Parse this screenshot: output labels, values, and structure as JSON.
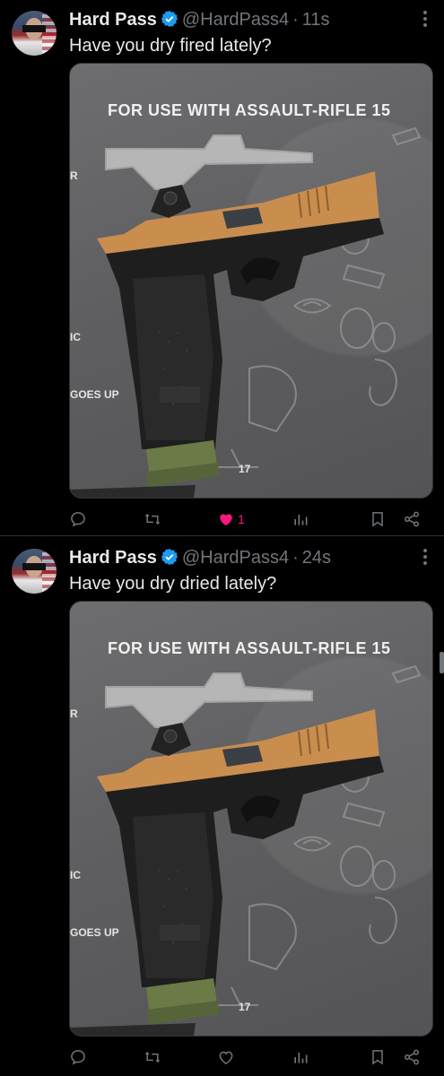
{
  "tweets": [
    {
      "author": "Hard Pass",
      "handle": "@HardPass4",
      "separator": "·",
      "time": "11s",
      "text": "Have you dry fired lately?",
      "media": {
        "banner": "FOR USE WITH ASSAULT-RIFLE 15",
        "labels": [
          "R",
          "IC",
          "GOES UP",
          "17"
        ]
      },
      "actions": {
        "reply_icon": "reply-icon",
        "retweet_icon": "retweet-icon",
        "like_icon": "heart-filled-icon",
        "like_count": "1",
        "views_icon": "views-icon",
        "bookmark_icon": "bookmark-icon",
        "share_icon": "share-icon"
      },
      "liked": true
    },
    {
      "author": "Hard Pass",
      "handle": "@HardPass4",
      "separator": "·",
      "time": "24s",
      "text": "Have you dry dried lately?",
      "media": {
        "banner": "FOR USE WITH ASSAULT-RIFLE 15",
        "labels": [
          "R",
          "IC",
          "GOES UP",
          "17"
        ]
      },
      "actions": {
        "reply_icon": "reply-icon",
        "retweet_icon": "retweet-icon",
        "like_icon": "heart-outline-icon",
        "like_count": "",
        "views_icon": "views-icon",
        "bookmark_icon": "bookmark-icon",
        "share_icon": "share-icon"
      },
      "liked": false
    }
  ],
  "colors": {
    "background": "#000000",
    "text": "#e7e9ea",
    "secondary": "#71767b",
    "verified": "#1d9bf0",
    "like": "#f91880",
    "slide_tan": "#c98d4e",
    "frame_black": "#1e1e1e",
    "magazine_green": "#6b7a46"
  }
}
